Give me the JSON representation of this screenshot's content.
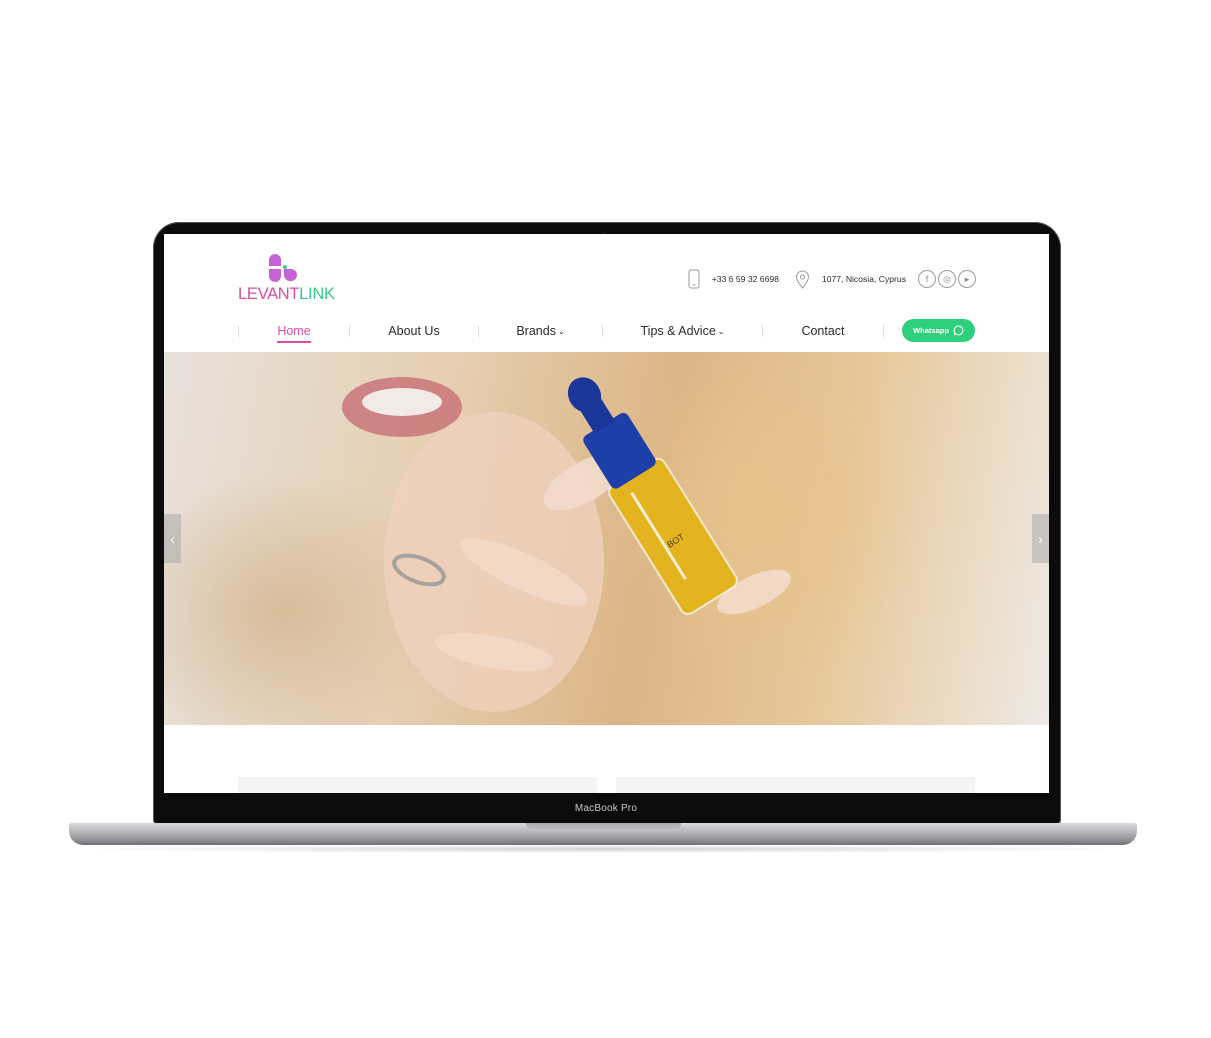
{
  "device": {
    "label": "MacBook Pro"
  },
  "site": {
    "logo": {
      "part1": "LEVANT",
      "part2": "LINK"
    },
    "contact": {
      "phone": "+33 6 59 32 6698",
      "address": "1077, Nicosia, Cyprus"
    },
    "social": [
      {
        "icon": "facebook-icon",
        "glyph": "f"
      },
      {
        "icon": "instagram-icon",
        "glyph": "◎"
      },
      {
        "icon": "youtube-icon",
        "glyph": "▸"
      }
    ],
    "nav": {
      "items": [
        {
          "label": "Home",
          "active": true
        },
        {
          "label": "About Us"
        },
        {
          "label": "Brands",
          "dropdown": true
        },
        {
          "label": "Tips & Advice",
          "dropdown": true
        },
        {
          "label": "Contact"
        }
      ],
      "whatsapp_label": "Whatsapp"
    },
    "hero": {
      "prev_glyph": "‹",
      "next_glyph": "›"
    }
  },
  "colors": {
    "brand_pink": "#d84ea8",
    "brand_green": "#37c98a",
    "whatsapp": "#2fd07d"
  }
}
